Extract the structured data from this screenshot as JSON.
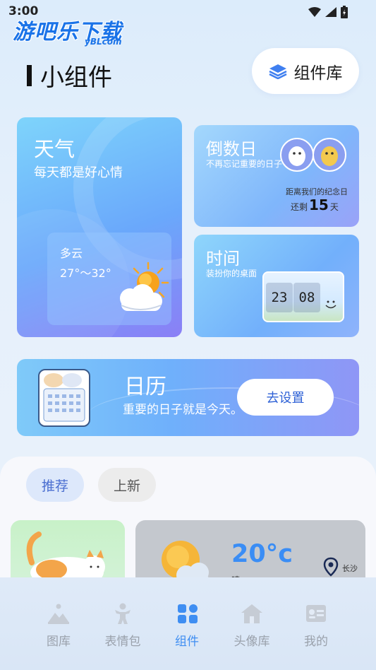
{
  "status_bar": {
    "time": "3:00"
  },
  "watermark": {
    "main": "游吧乐下载",
    "sub": "yBLcom"
  },
  "header": {
    "title": "小组件",
    "library_button_label": "组件库"
  },
  "weather_card": {
    "title": "天气",
    "subtitle": "每天都是好心情",
    "condition": "多云",
    "temperature": "27°～32°"
  },
  "countdown_card": {
    "title": "倒数日",
    "subtitle": "不再忘记重要的日子",
    "remaining_label": "距离我们的纪念日",
    "remaining_prefix": "还剩",
    "remaining_days": "15",
    "remaining_suffix": "天"
  },
  "time_card": {
    "title": "时间",
    "subtitle": "装扮你的桌面",
    "hour": "23",
    "minute": "08"
  },
  "calendar_card": {
    "title": "日历",
    "subtitle": "重要的日子就是今天。",
    "setup_button_label": "去设置"
  },
  "filter_chips": {
    "recommend": "推荐",
    "new": "上新"
  },
  "preview_weather": {
    "temperature": "20°c",
    "condition": "晴",
    "city": "长沙"
  },
  "tab_bar": {
    "items": [
      {
        "label": "图库",
        "icon": "gallery-icon"
      },
      {
        "label": "表情包",
        "icon": "emoji-pack-icon"
      },
      {
        "label": "组件",
        "icon": "widgets-icon"
      },
      {
        "label": "头像库",
        "icon": "avatar-library-icon"
      },
      {
        "label": "我的",
        "icon": "profile-card-icon"
      }
    ],
    "active_index": 2,
    "active_color": "#3f8ef2",
    "inactive_color": "#9aa1ab"
  }
}
